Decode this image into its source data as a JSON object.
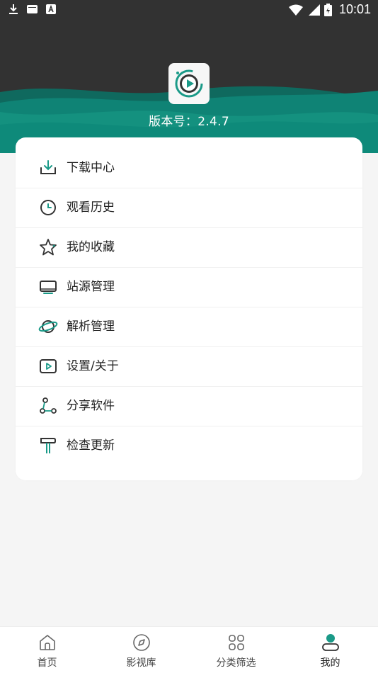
{
  "status_bar": {
    "time": "10:01",
    "icons": [
      "download-icon",
      "notification-icon",
      "a-icon",
      "wifi-icon",
      "signal-icon",
      "battery-icon"
    ]
  },
  "header": {
    "version_text": "版本号：2.4.7",
    "logo_icon": "app-play-logo-icon"
  },
  "menu": {
    "items": [
      {
        "label": "下载中心",
        "icon": "download-tray-icon"
      },
      {
        "label": "观看历史",
        "icon": "clock-icon"
      },
      {
        "label": "我的收藏",
        "icon": "star-icon"
      },
      {
        "label": "站源管理",
        "icon": "monitor-icon"
      },
      {
        "label": "解析管理",
        "icon": "planet-icon"
      },
      {
        "label": "设置/关于",
        "icon": "play-box-icon"
      },
      {
        "label": "分享软件",
        "icon": "share-icon"
      },
      {
        "label": "检查更新",
        "icon": "paint-roller-icon"
      }
    ]
  },
  "bottom_nav": {
    "tabs": [
      {
        "label": "首页",
        "icon": "home-icon",
        "active": false
      },
      {
        "label": "影视库",
        "icon": "compass-icon",
        "active": false
      },
      {
        "label": "分类筛选",
        "icon": "grid-icon",
        "active": false
      },
      {
        "label": "我的",
        "icon": "user-icon",
        "active": true
      }
    ]
  },
  "colors": {
    "accent": "#1a9a88",
    "header_dark": "#323232",
    "wave_teal": "#0e8a7a"
  }
}
